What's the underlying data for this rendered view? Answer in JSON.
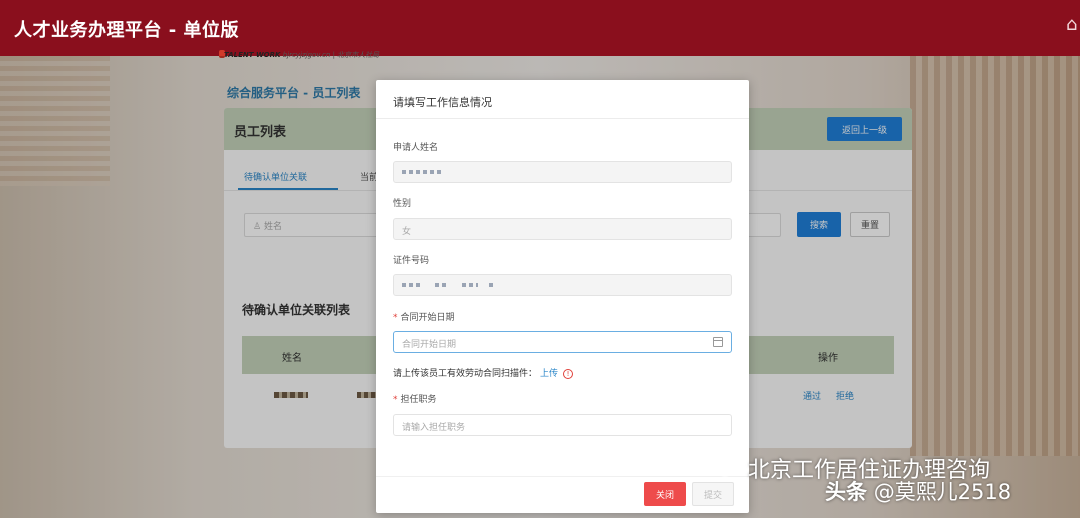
{
  "topbar": {
    "title": "人才业务办理平台 - 单位版",
    "home_icon": "home-icon"
  },
  "background_page": {
    "logo_text": "TALENT WORK",
    "logo_url": "bjrcyjzjgov.cn",
    "logo_subtitle": "| 北京市人社局",
    "breadcrumb": "综合服务平台 - 员工列表",
    "panel_title": "员工列表",
    "back_button": "返回上一级",
    "tabs": [
      {
        "label": "待确认单位关联",
        "active": true
      },
      {
        "label": "当前",
        "active": false
      }
    ],
    "search_placeholder": "姓名",
    "search_button": "搜索",
    "reset_button": "重置",
    "list_title": "待确认单位关联列表",
    "table_headers": {
      "name": "姓名",
      "operation": "操作"
    },
    "row_actions": {
      "approve": "通过",
      "reject": "拒绝"
    }
  },
  "modal": {
    "title": "请填写工作信息情况",
    "fields": {
      "applicant_name": {
        "label": "申请人姓名"
      },
      "gender": {
        "label": "性别",
        "value": "女"
      },
      "id_number": {
        "label": "证件号码"
      },
      "contract_start": {
        "label": "合同开始日期",
        "placeholder": "合同开始日期",
        "required": true
      },
      "position": {
        "label": "担任职务",
        "placeholder": "请输入担任职务",
        "required": true
      }
    },
    "upload": {
      "text": "请上传该员工有效劳动合同扫描件：",
      "link": "上传",
      "info_icon": "!"
    },
    "buttons": {
      "close": "关闭",
      "submit": "提交"
    }
  },
  "watermarks": {
    "account": "北京工作居住证办理咨询",
    "brand": "头条",
    "handle": "@莫熙儿2518"
  },
  "colors": {
    "topbar": "#8a0f1d",
    "primary": "#1f7fd9",
    "danger": "#ee4b4b",
    "table_header": "#c4d3ba"
  }
}
